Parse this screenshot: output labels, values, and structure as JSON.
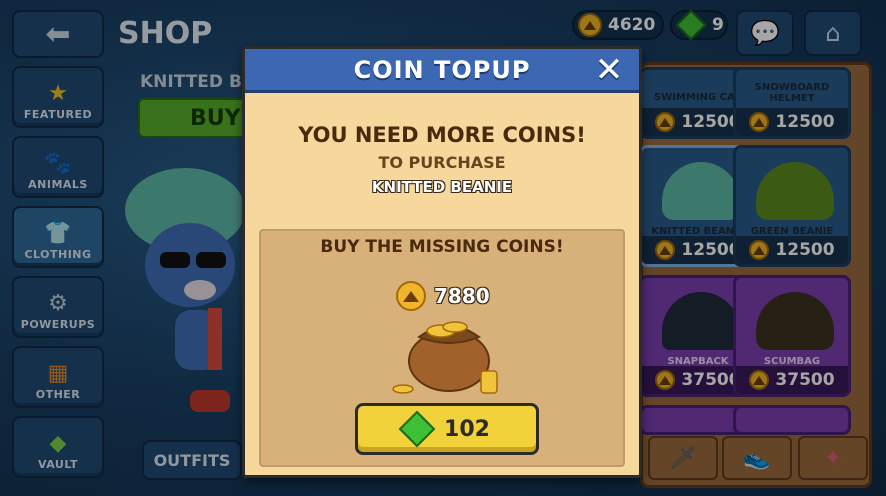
{
  "shop": {
    "title": "SHOP",
    "item_name": "KNITTED BEANIE",
    "buy_label": "BUY",
    "outfits_label": "OUTFITS"
  },
  "currency": {
    "coins": "4620",
    "gems": "9"
  },
  "nav": [
    {
      "label": "FEATURED",
      "icon": "star-icon"
    },
    {
      "label": "ANIMALS",
      "icon": "paw-icon"
    },
    {
      "label": "CLOTHING",
      "icon": "shirt-icon"
    },
    {
      "label": "POWERUPS",
      "icon": "gear-icon"
    },
    {
      "label": "OTHER",
      "icon": "grid-icon"
    },
    {
      "label": "VAULT",
      "icon": "vault-icon"
    }
  ],
  "grid": [
    {
      "name": "SWIMMING CAP",
      "price": "12500"
    },
    {
      "name": "SNOWBOARD HELMET",
      "price": "12500"
    },
    {
      "name": "KNITTED BEANIE",
      "price": "12500"
    },
    {
      "name": "GREEN BEANIE",
      "price": "12500"
    },
    {
      "name": "SNAPBACK",
      "price": "37500"
    },
    {
      "name": "SCUMBAG",
      "price": "37500"
    }
  ],
  "modal": {
    "title": "COIN TOPUP",
    "close_glyph": "✕",
    "message": "YOU NEED MORE COINS!",
    "sub": "TO PURCHASE",
    "item": "KNITTED BEANIE",
    "buy_missing": "BUY THE MISSING COINS!",
    "missing_coins": "7880",
    "gem_price": "102"
  },
  "colors": {
    "header_blue": "#3c67b3",
    "modal_bg": "#f6d79c",
    "button_yellow": "#f2d23a",
    "gem_green": "#3fbf36",
    "coin_gold": "#f0b52a"
  }
}
